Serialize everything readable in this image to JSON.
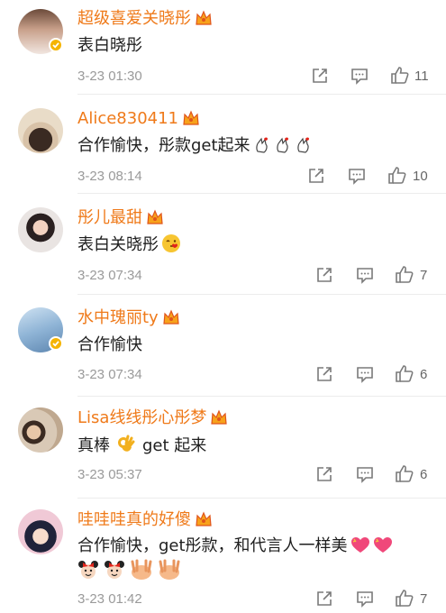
{
  "comments": [
    {
      "username": "超级喜爱关晓彤",
      "text": "表白晓彤",
      "time": "3-23 01:30",
      "likes": "11",
      "verified": true
    },
    {
      "username": "Alice830411",
      "text": "合作愉快，彤款get起来",
      "time": "3-23 08:14",
      "likes": "10",
      "verified": false
    },
    {
      "username": "彤儿最甜",
      "text": "表白关晓彤",
      "time": "3-23 07:34",
      "likes": "7",
      "verified": false
    },
    {
      "username": "水中瑰丽ty",
      "text": "合作愉快",
      "time": "3-23 07:34",
      "likes": "6",
      "verified": true
    },
    {
      "username": "Lisa线线彤心彤梦",
      "text_before": "真棒",
      "text_after": "get 起来",
      "time": "3-23 05:37",
      "likes": "6",
      "verified": false
    },
    {
      "username": "哇哇哇真的好傻",
      "text": "合作愉快，get彤款，和代言人一样美",
      "time": "3-23 01:42",
      "likes": "7",
      "verified": false
    }
  ],
  "icons": {
    "crown": "crown-badge-icon",
    "share": "share-icon",
    "comment": "comment-icon",
    "like": "thumbs-up-icon"
  },
  "colors": {
    "username": "#ef7a1a",
    "text": "#1e1e1e",
    "meta": "#9a9a9a",
    "badge": "#f5b400"
  }
}
